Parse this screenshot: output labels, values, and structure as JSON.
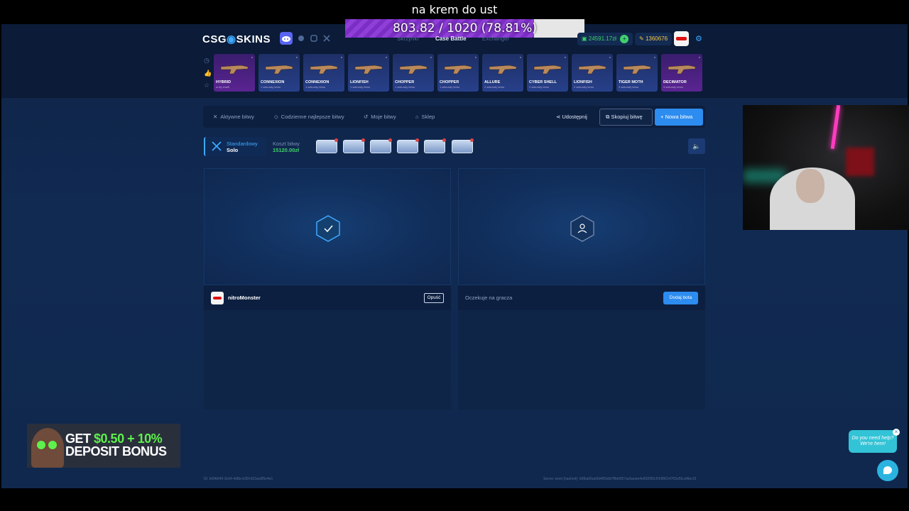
{
  "overlay": {
    "title": "na krem do ust",
    "goal_text": "803.82 / 1020 (78.81%)",
    "goal_fraction": 0.7881
  },
  "header": {
    "logo_left": "CSG",
    "logo_right": "SKINS",
    "nav": [
      "Skrzynki",
      "Case Battle",
      "Exchanger"
    ],
    "balance": "24591.17zł",
    "points": "1360676"
  },
  "drops": [
    {
      "name": "HYBRID",
      "sub": "w tej chwili",
      "tier": "purple"
    },
    {
      "name": "CONNEXION",
      "sub": "1 sekundy temu",
      "tier": "blue"
    },
    {
      "name": "CONNEXION",
      "sub": "1 sekundy temu",
      "tier": "blue"
    },
    {
      "name": "LIONFISH",
      "sub": "1 sekundy temu",
      "tier": "blue"
    },
    {
      "name": "CHOPPER",
      "sub": "1 sekundy temu",
      "tier": "blue"
    },
    {
      "name": "CHOPPER",
      "sub": "1 sekundy temu",
      "tier": "blue"
    },
    {
      "name": "ALLURE",
      "sub": "2 sekundy temu",
      "tier": "blue"
    },
    {
      "name": "CYBER SHELL",
      "sub": "2 sekundy temu",
      "tier": "blue"
    },
    {
      "name": "LIONFISH",
      "sub": "2 sekundy temu",
      "tier": "blue"
    },
    {
      "name": "TIGER MOTH",
      "sub": "3 sekundy temu",
      "tier": "blue"
    },
    {
      "name": "DECIMATOR",
      "sub": "3 sekundy temu",
      "tier": "purple"
    }
  ],
  "tabs": {
    "active_battles": "Aktywne bitwy",
    "daily_best": "Codzienne najlepsze bitwy",
    "my_battles": "Moje bitwy",
    "shop": "Sklep",
    "share": "Udostępnij",
    "copy": "Skopiuj bitwę",
    "new": "+ Nowa bitwa"
  },
  "battle": {
    "mode_label": "Standardowy",
    "mode_value": "Solo",
    "cost_label": "Koszt bitwy",
    "cost_value": "15120.00zł",
    "case_count": 6
  },
  "players": {
    "p1_name": "nitroMonster",
    "p1_leave": "Opuść",
    "p2_waiting": "Oczekuje na gracza",
    "p2_add_bot": "Dodaj bota"
  },
  "footer": {
    "id": "ID: bf34bf40-3c94-4d8e-b35f-b53ac8f5e4e1",
    "seed": "Server seed (hashed): b0fba66ae5d4f55dd7ff8ef357ac6aeee4e830f50c543f8014765e55cd4be15"
  },
  "promo": {
    "line1_a": "GET",
    "line1_b": "$0.50 + 10%",
    "line2": "DEPOSIT BONUS"
  },
  "help": {
    "line1": "Do you need help?",
    "line2": "We're here!"
  }
}
